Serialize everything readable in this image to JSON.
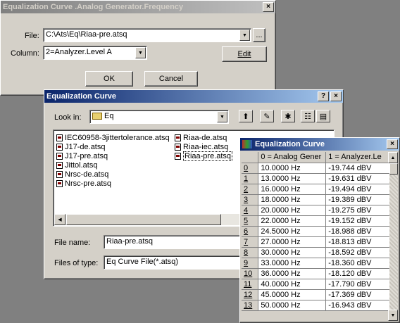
{
  "main_window": {
    "title": "Equalization Curve .Analog Generator.Frequency",
    "file_label": "File:",
    "file_value": "C:\\Ats\\Eq\\Riaa-pre.atsq",
    "browse_label": "...",
    "column_label": "Column:",
    "column_value": "2=Analyzer.Level A",
    "edit_label": "Edit",
    "ok_label": "OK",
    "cancel_label": "Cancel",
    "close_label": "×"
  },
  "file_dialog": {
    "title": "Equalization Curve",
    "help_label": "?",
    "close_label": "×",
    "look_in_label": "Look in:",
    "look_in_value": "Eq",
    "files": [
      "IEC60958-3jittertolerance.atsq",
      "J17-de.atsq",
      "J17-pre.atsq",
      "Jittol.atsq",
      "Nrsc-de.atsq",
      "Nrsc-pre.atsq",
      "Riaa-de.atsq",
      "Riaa-iec.atsq",
      "Riaa-pre.atsq"
    ],
    "file_name_label": "File name:",
    "file_name_value": "Riaa-pre.atsq",
    "files_of_type_label": "Files of type:",
    "files_of_type_value": "Eq Curve File(*.atsq)"
  },
  "curve_window": {
    "title": "Equalization Curve",
    "close_label": "×",
    "col0": "0 = Analog Gener",
    "col1": "1 = Analyzer.Le",
    "rows": [
      [
        "0",
        "10.0000  Hz",
        "-19.744  dBV"
      ],
      [
        "1",
        "13.0000  Hz",
        "-19.631  dBV"
      ],
      [
        "2",
        "16.0000  Hz",
        "-19.494  dBV"
      ],
      [
        "3",
        "18.0000  Hz",
        "-19.389  dBV"
      ],
      [
        "4",
        "20.0000  Hz",
        "-19.275  dBV"
      ],
      [
        "5",
        "22.0000  Hz",
        "-19.152  dBV"
      ],
      [
        "6",
        "24.5000  Hz",
        "-18.988  dBV"
      ],
      [
        "7",
        "27.0000  Hz",
        "-18.813  dBV"
      ],
      [
        "8",
        "30.0000  Hz",
        "-18.592  dBV"
      ],
      [
        "9",
        "33.0000  Hz",
        "-18.360  dBV"
      ],
      [
        "10",
        "36.0000  Hz",
        "-18.120  dBV"
      ],
      [
        "11",
        "40.0000  Hz",
        "-17.790  dBV"
      ],
      [
        "12",
        "45.0000  Hz",
        "-17.369  dBV"
      ],
      [
        "13",
        "50.0000  Hz",
        "-16.943  dBV"
      ]
    ]
  }
}
